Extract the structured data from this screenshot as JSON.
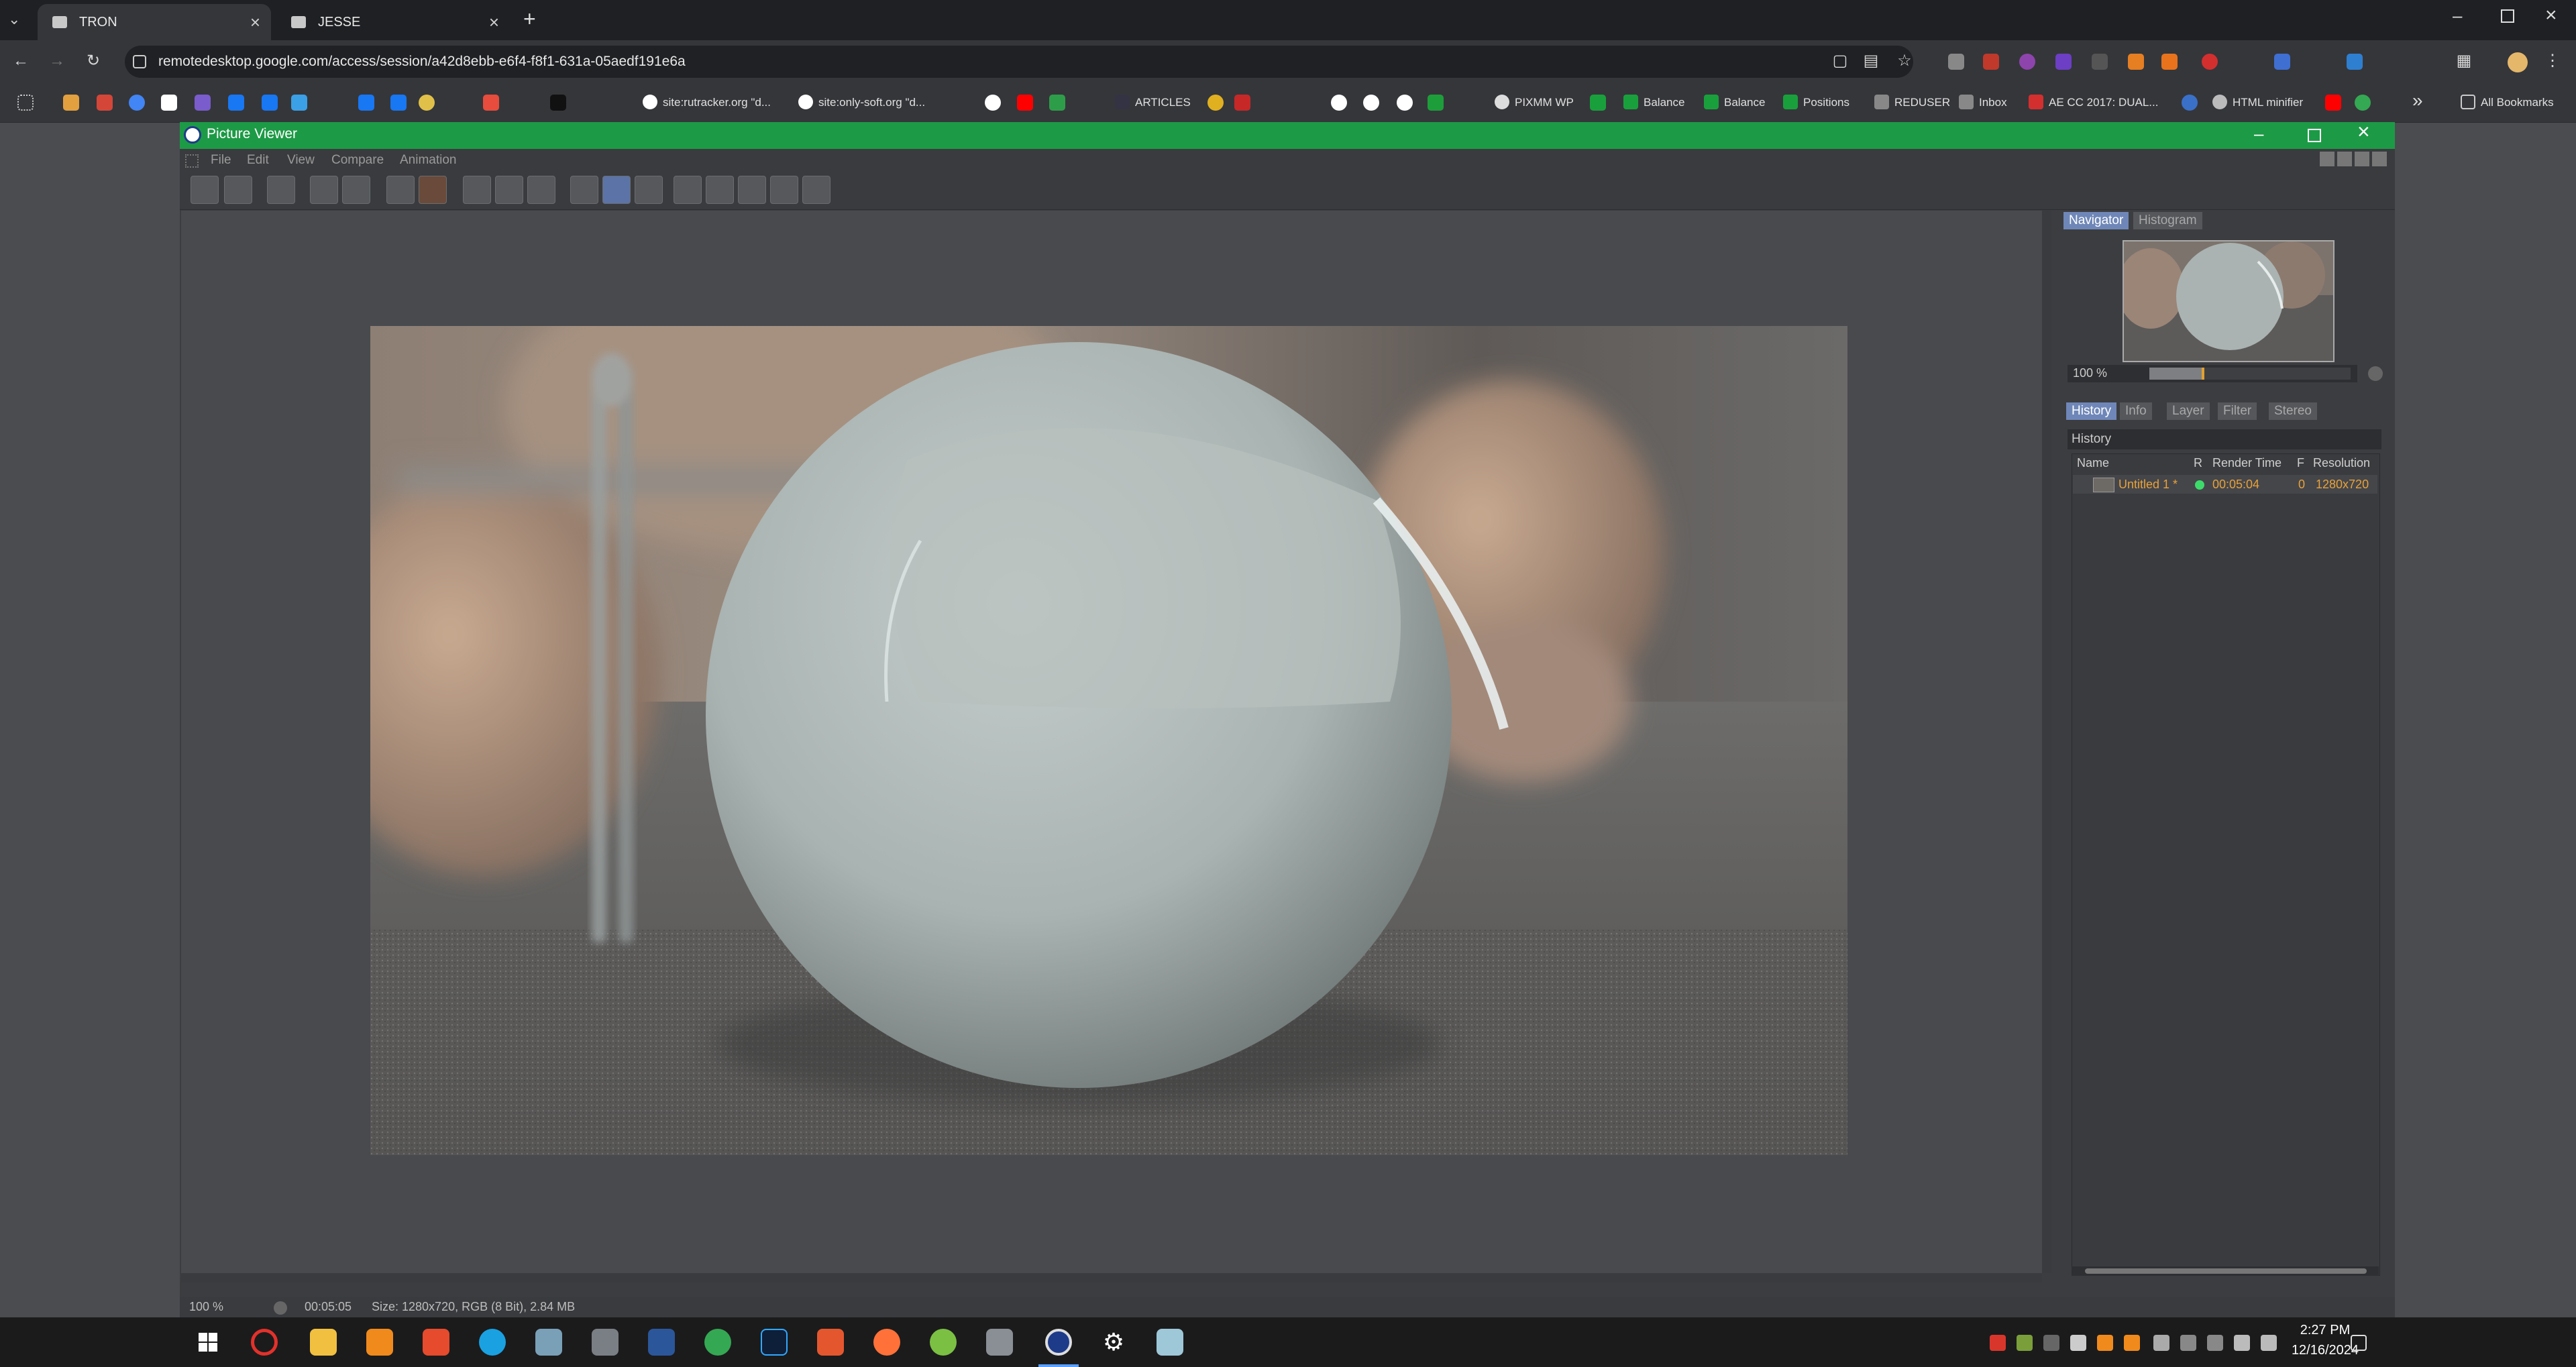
{
  "browser": {
    "tabs": [
      {
        "title": "TRON",
        "active": true
      },
      {
        "title": "JESSE",
        "active": false
      }
    ],
    "new_tab": "+",
    "url": "remotedesktop.google.com/access/session/a42d8ebb-e6f4-f8f1-631a-05aedf191e6a",
    "bookmarks": [
      "site:rutracker.org \"d...",
      "site:only-soft.org \"d...",
      "ARTICLES",
      "PIXMM WP",
      "Balance",
      "Balance",
      "Positions",
      "REDUSER",
      "Inbox",
      "AE CC 2017: DUAL...",
      "HTML minifier"
    ],
    "all_bookmarks": "All Bookmarks"
  },
  "app": {
    "title": "Picture Viewer",
    "menu": [
      "File",
      "Edit",
      "View",
      "Compare",
      "Animation"
    ],
    "panel": {
      "top_tabs": [
        "Navigator",
        "Histogram"
      ],
      "zoom": "100 %",
      "bottom_tabs": [
        "History",
        "Info",
        "Layer",
        "Filter",
        "Stereo"
      ],
      "history_label": "History",
      "columns": [
        "Name",
        "R",
        "Render Time",
        "F",
        "Resolution"
      ],
      "rows": [
        {
          "name": "Untitled 1 *",
          "render_time": "00:05:04",
          "f": "0",
          "resolution": "1280x720"
        }
      ]
    },
    "status": {
      "zoom": "100 %",
      "time": "00:05:05",
      "info": "Size: 1280x720, RGB (8 Bit), 2.84 MB"
    }
  },
  "taskbar": {
    "time": "2:27 PM",
    "date": "12/16/2024"
  },
  "colors": {
    "titlebar": "#1d9a46",
    "history_text": "#e8a23a",
    "active_panel_tab": "#6f87b8"
  }
}
